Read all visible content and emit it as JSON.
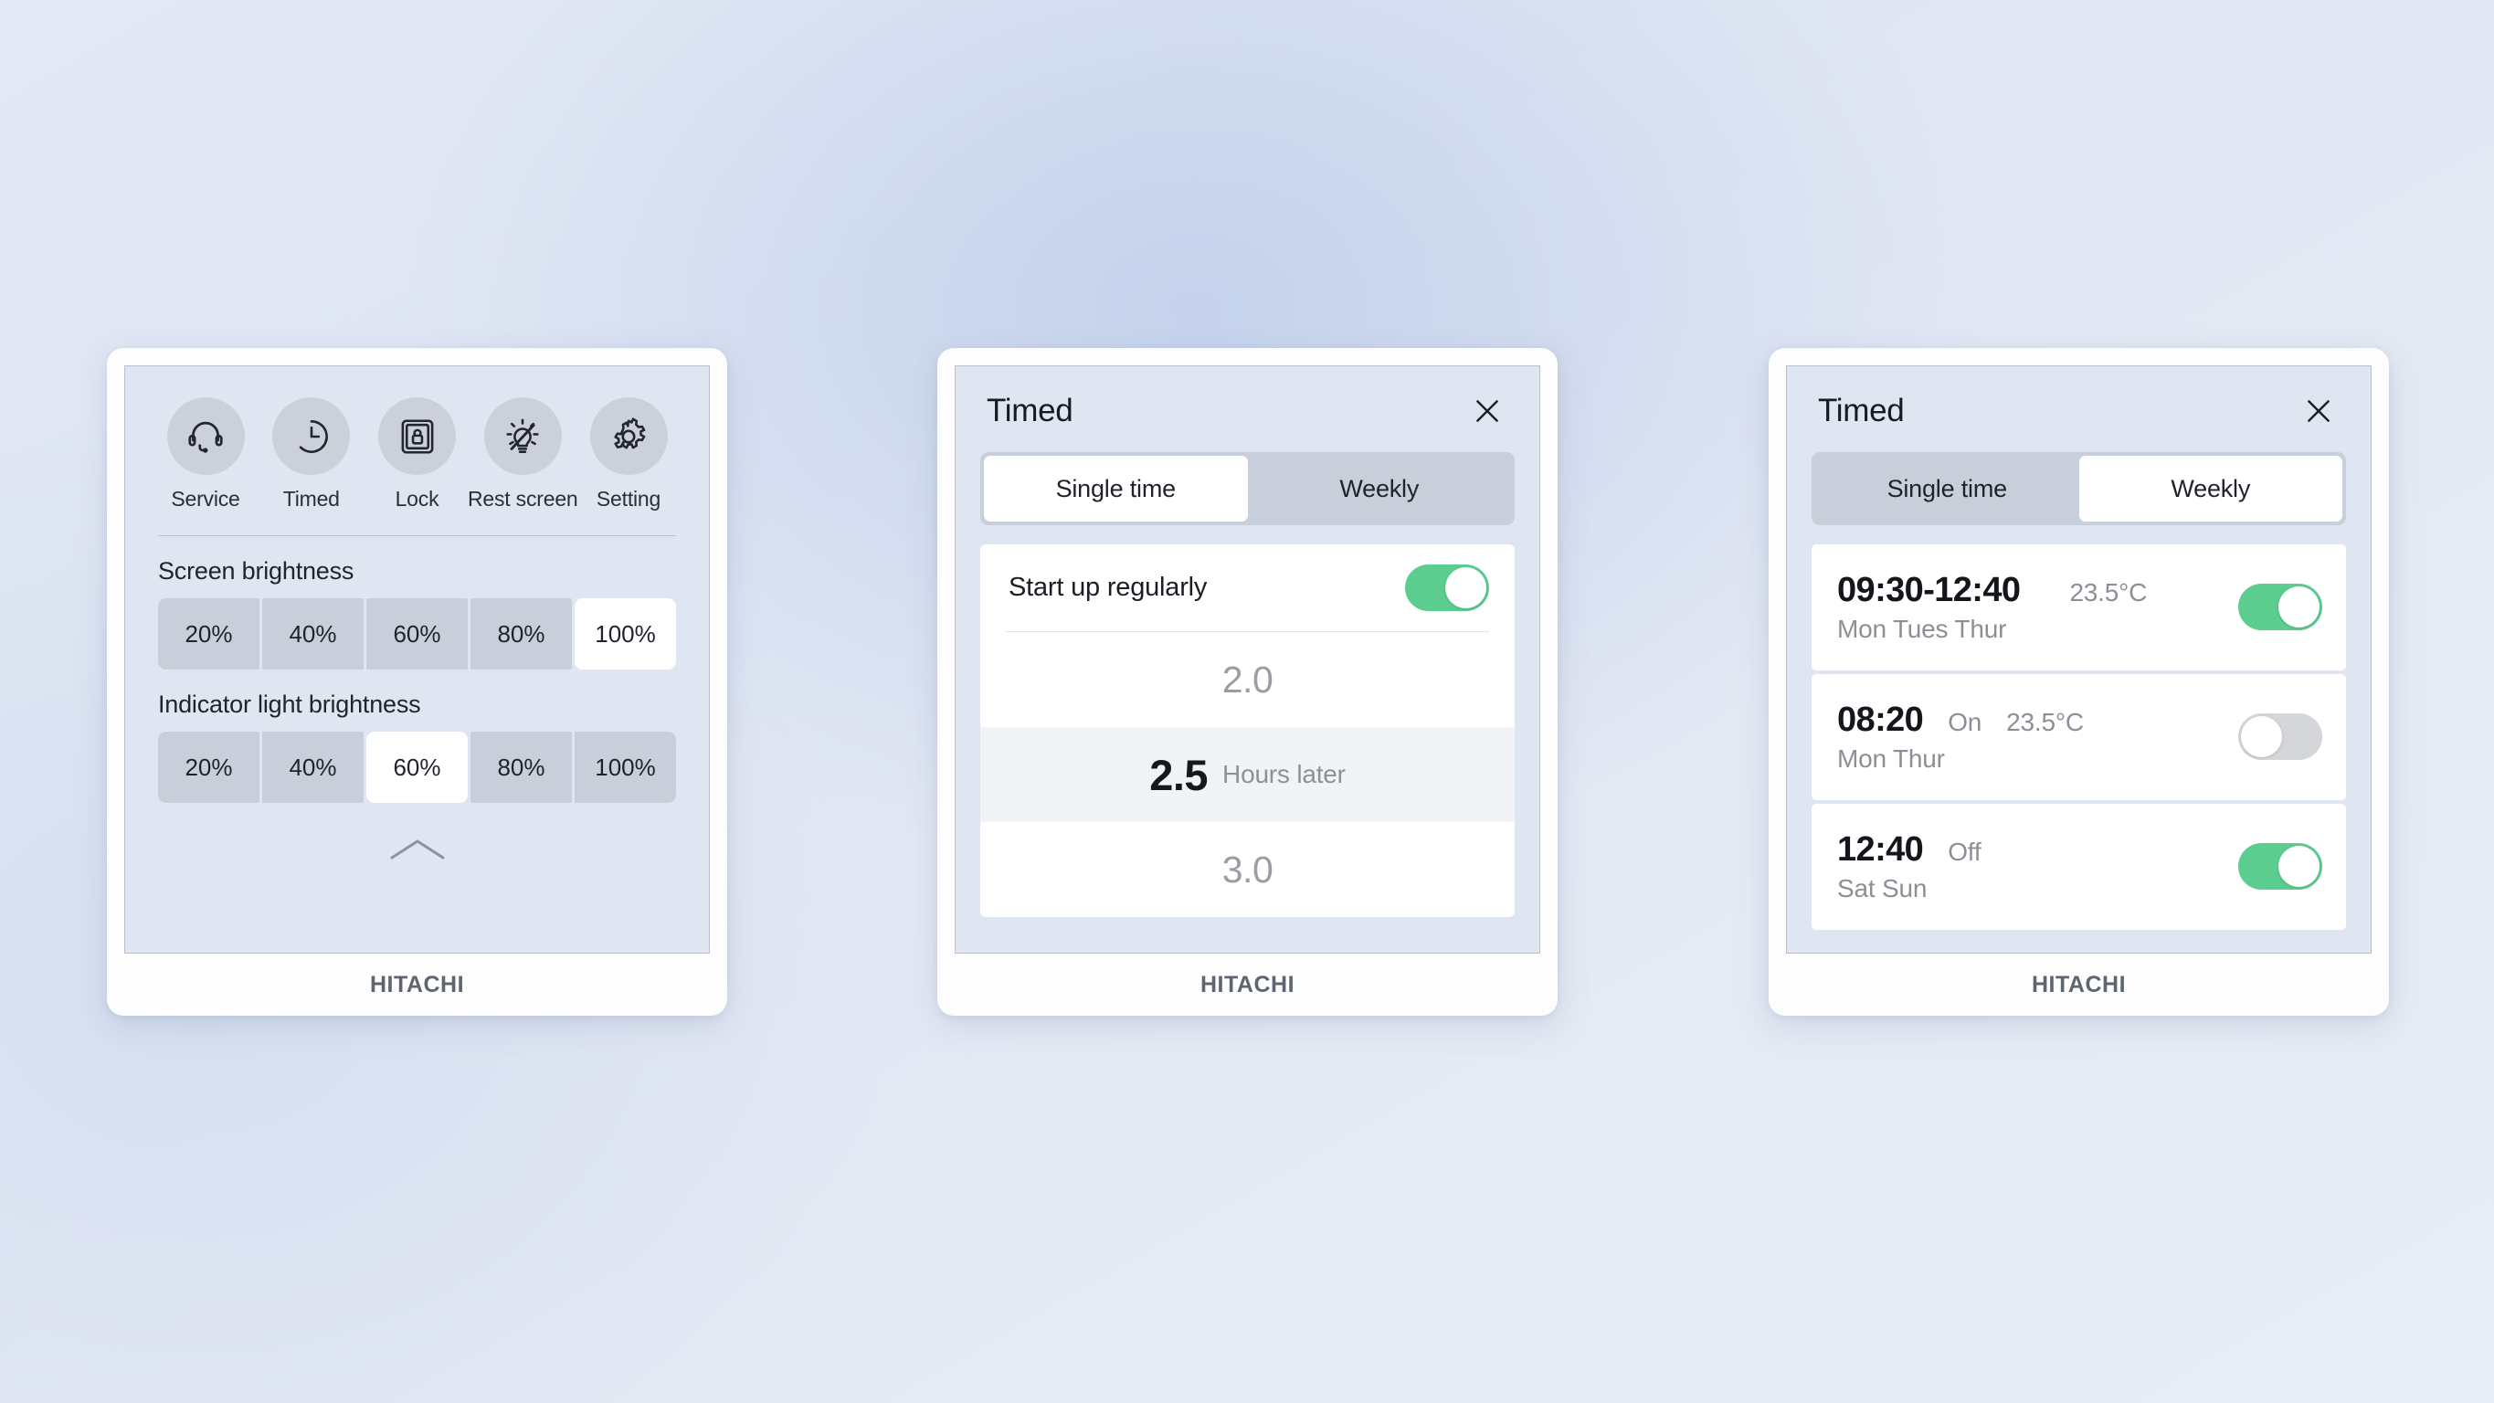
{
  "brand": "HITACHI",
  "controls_panel": {
    "quick_actions": [
      {
        "icon": "headset-icon",
        "label": "Service"
      },
      {
        "icon": "clock-timer-icon",
        "label": "Timed"
      },
      {
        "icon": "screen-lock-icon",
        "label": "Lock"
      },
      {
        "icon": "bulb-off-icon",
        "label": "Rest screen"
      },
      {
        "icon": "gear-icon",
        "label": "Setting"
      }
    ],
    "screen_brightness": {
      "title": "Screen brightness",
      "options": [
        "20%",
        "40%",
        "60%",
        "80%",
        "100%"
      ],
      "selected": "100%"
    },
    "indicator_brightness": {
      "title": "Indicator light brightness",
      "options": [
        "20%",
        "40%",
        "60%",
        "80%",
        "100%"
      ],
      "selected": "60%"
    },
    "collapse_icon": "chevron-up-icon"
  },
  "timed_single": {
    "title": "Timed",
    "close_icon": "close-icon",
    "tabs": [
      {
        "label": "Single time",
        "active": true
      },
      {
        "label": "Weekly",
        "active": false
      }
    ],
    "toggle_label": "Start up regularly",
    "toggle_on": true,
    "unit_label": "Hours later",
    "picker": [
      {
        "value": "2.0",
        "selected": false
      },
      {
        "value": "2.5",
        "selected": true
      },
      {
        "value": "3.0",
        "selected": false
      }
    ]
  },
  "timed_weekly": {
    "title": "Timed",
    "close_icon": "close-icon",
    "tabs": [
      {
        "label": "Single time",
        "active": false
      },
      {
        "label": "Weekly",
        "active": true
      }
    ],
    "schedules": [
      {
        "time": "09:30-12:40",
        "mode": "",
        "temp": "23.5°C",
        "days": "Mon Tues Thur",
        "enabled": true
      },
      {
        "time": "08:20",
        "mode": "On",
        "temp": "23.5°C",
        "days": "Mon Thur",
        "enabled": false
      },
      {
        "time": "12:40",
        "mode": "Off",
        "temp": "",
        "days": "Sat Sun",
        "enabled": true
      }
    ]
  },
  "colors": {
    "toggle_on": "#5bcd8e",
    "toggle_off": "#d4d6d9",
    "panel_bg": "#dfe5f1",
    "segment_bg": "#c9cfda",
    "brand_text": "#5d6571"
  }
}
